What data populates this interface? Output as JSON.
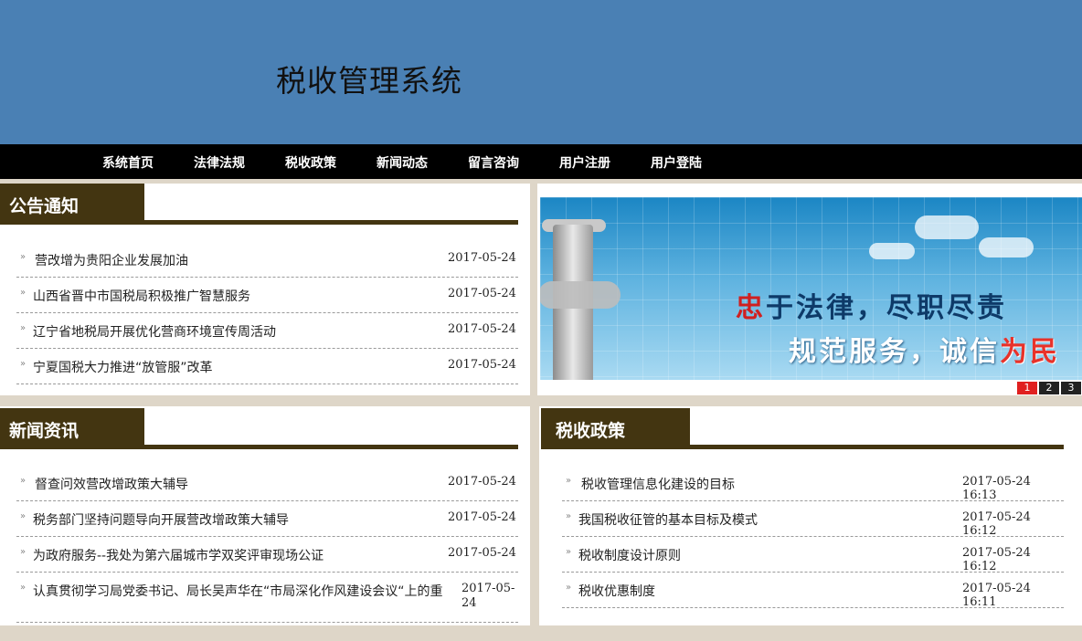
{
  "header": {
    "title": "税收管理系统"
  },
  "nav": [
    "系统首页",
    "法律法规",
    "税收政策",
    "新闻动态",
    "留言咨询",
    "用户注册",
    "用户登陆"
  ],
  "notice": {
    "title": "公告通知",
    "items": [
      {
        "title": "营改增为贵阳企业发展加油",
        "date": "2017-05-24"
      },
      {
        "title": "山西省晋中市国税局积极推广智慧服务",
        "date": "2017-05-24"
      },
      {
        "title": "辽宁省地税局开展优化营商环境宣传周活动",
        "date": "2017-05-24"
      },
      {
        "title": "宁夏国税大力推进“放管服”改革",
        "date": "2017-05-24"
      }
    ]
  },
  "banner": {
    "slogan_line1_first": "忠",
    "slogan_line1_rest": "于法律，尽职尽责",
    "slogan_line2_first": "规范服务，诚信",
    "slogan_line2_last": "为民",
    "pages": [
      "1",
      "2",
      "3"
    ],
    "active_page": "1"
  },
  "news": {
    "title": "新闻资讯",
    "items": [
      {
        "title": "督查问效营改增政策大辅导",
        "date": "2017-05-24"
      },
      {
        "title": "税务部门坚持问题导向开展营改增政策大辅导",
        "date": "2017-05-24"
      },
      {
        "title": "为政府服务--我处为第六届城市学双奖评审现场公证",
        "date": "2017-05-24"
      },
      {
        "title": "认真贯彻学习局党委书记、局长吴声华在“市局深化作风建设会议“上的重",
        "date": "2017-05-24"
      }
    ]
  },
  "policy": {
    "title": "税收政策",
    "items": [
      {
        "title": "税收管理信息化建设的目标",
        "date": "2017-05-24 16:13"
      },
      {
        "title": "我国税收征管的基本目标及模式",
        "date": "2017-05-24 16:12"
      },
      {
        "title": "税收制度设计原则",
        "date": "2017-05-24 16:12"
      },
      {
        "title": "税收优惠制度",
        "date": "2017-05-24 16:11"
      }
    ]
  },
  "colors": {
    "header_bg": "#4a80b4",
    "nav_bg": "#000000",
    "tab_bg": "#433511",
    "page_bg": "#ded6c8",
    "active_pager": "#e02020"
  }
}
